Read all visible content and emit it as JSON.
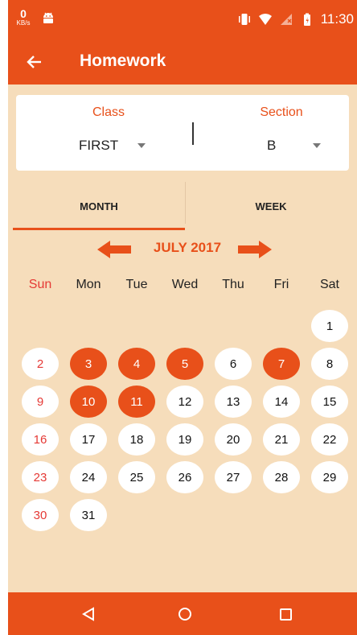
{
  "status_bar": {
    "speed_value": "0",
    "speed_unit": "KB/s",
    "time": "11:30",
    "icons": [
      "android-icon",
      "vibrate-icon",
      "wifi-icon",
      "signal-icon",
      "battery-icon"
    ]
  },
  "app_bar": {
    "title": "Homework",
    "back_icon": "arrow-left-icon"
  },
  "filters": {
    "class_label": "Class",
    "class_value": "FIRST",
    "section_label": "Section",
    "section_value": "B"
  },
  "tabs": {
    "month": "MONTH",
    "week": "WEEK",
    "selected": "MONTH"
  },
  "calendar": {
    "month_title": "JULY 2017",
    "weekdays": [
      "Sun",
      "Mon",
      "Tue",
      "Wed",
      "Thu",
      "Fri",
      "Sat"
    ],
    "first_weekday_index": 6,
    "days_in_month": 31,
    "homework_days": [
      3,
      4,
      5,
      7,
      10,
      11
    ]
  },
  "colors": {
    "accent": "#e8501a",
    "background": "#f6ddbb",
    "sunday": "#e53935"
  },
  "nav_bar": {
    "icons": [
      "nav-back-icon",
      "nav-home-icon",
      "nav-recents-icon"
    ]
  }
}
